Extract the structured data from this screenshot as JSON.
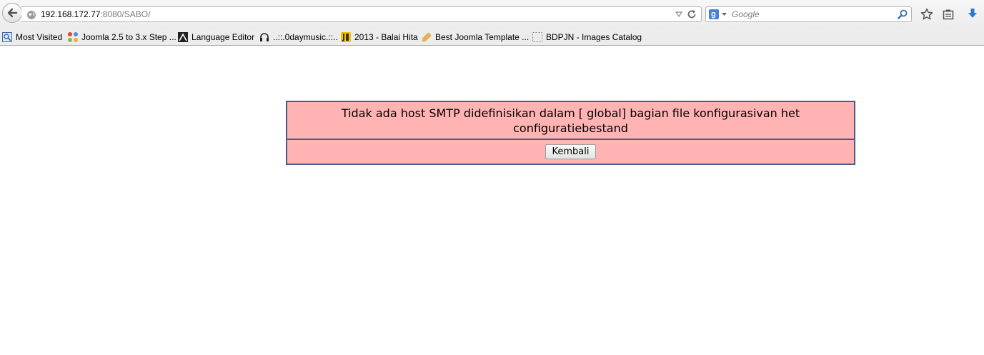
{
  "browser": {
    "url": {
      "host": "192.168.172.77",
      "rest": ":8080/SABO/"
    },
    "search": {
      "placeholder": "Google"
    }
  },
  "bookmarks": [
    {
      "label": "Most Visited",
      "icon": "most-visited-icon"
    },
    {
      "label": "Joomla 2.5 to 3.x Step ...",
      "icon": "joomla-icon"
    },
    {
      "label": "Language Editor",
      "icon": "language-editor-icon"
    },
    {
      "label": "..::.0daymusic.::..",
      "icon": "headphones-icon"
    },
    {
      "label": "2013 - Balai Hita",
      "icon": "balai-hita-icon"
    },
    {
      "label": "Best Joomla Template ...",
      "icon": "template-icon"
    },
    {
      "label": "BDPJN - Images Catalog",
      "icon": "blank-page-icon"
    }
  ],
  "page": {
    "message": "Tidak ada host SMTP didefinisikan dalam [ global] bagian file konfigurasivan het configuratiebestand",
    "back_button": "Kembali",
    "colors": {
      "box_background": "#ffb3b3",
      "box_border": "#4a5a86"
    }
  }
}
